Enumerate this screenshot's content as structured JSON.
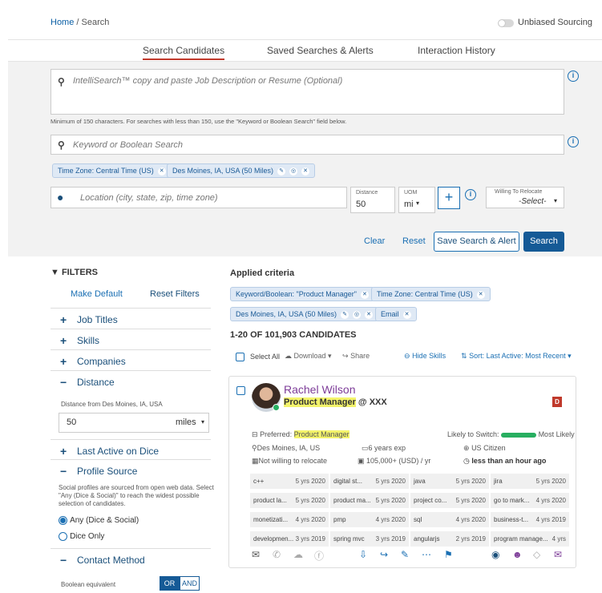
{
  "breadcrumb": {
    "home": "Home",
    "sep": "/",
    "current": "Search"
  },
  "unbiased": "Unbiased Sourcing",
  "tabs": [
    "Search Candidates",
    "Saved Searches & Alerts",
    "Interaction History"
  ],
  "intellisearch": {
    "placeholder": "IntelliSearch™ copy and paste Job Description or Resume (Optional)",
    "hint": "Minimum of 150 characters. For searches with less than 150, use the \"Keyword or Boolean Search\" field below."
  },
  "keyword": {
    "placeholder": "Keyword or Boolean Search"
  },
  "chips": {
    "timezone": "Time Zone: Central Time (US)",
    "location": "Des Moines, IA, USA (50 Miles)"
  },
  "location": {
    "placeholder": "Location (city, state, zip, time zone)",
    "distance_label": "Distance",
    "distance_value": "50",
    "uom_label": "UOM",
    "uom_value": "mi",
    "relocate_label": "Willing To Relocate",
    "relocate_value": "-Select-"
  },
  "actions": {
    "clear": "Clear",
    "reset": "Reset",
    "save": "Save Search & Alert",
    "search": "Search"
  },
  "filters": {
    "title": "FILTERS",
    "make_default": "Make Default",
    "reset": "Reset Filters",
    "sections": [
      "Job Titles",
      "Skills",
      "Companies",
      "Distance",
      "Last Active on Dice",
      "Profile Source",
      "Contact Method"
    ],
    "distance_from": "Distance from Des Moines, IA, USA",
    "distance_value": "50",
    "distance_unit": "miles",
    "source_note": "Social profiles are sourced from open web data. Select \"Any (Dice & Social)\" to reach the widest possible selection of candidates.",
    "source_any": "Any (Dice & Social)",
    "source_dice": "Dice Only",
    "boolean_label": "Boolean equivalent",
    "or": "OR",
    "and": "AND"
  },
  "applied": {
    "title": "Applied criteria",
    "chips": [
      "Keyword/Boolean: \"Product Manager\"",
      "Time Zone: Central Time (US)",
      "Des Moines, IA, USA (50 Miles)",
      "Email"
    ]
  },
  "results": {
    "count": "1-20 OF 101,903 CANDIDATES",
    "select_all": "Select All",
    "download": "Download",
    "share": "Share",
    "hide_skills": "Hide Skills",
    "sort": "Sort: Last Active: Most Recent"
  },
  "candidate": {
    "name": "Rachel Wilson",
    "title": "Product Manager",
    "company": "@ XXX",
    "preferred_label": "Preferred:",
    "preferred": "Product Manager",
    "likely": "Likely to Switch:",
    "likely_value": "Most Likely",
    "location": "Des Moines, IA, US",
    "exp": "6 years exp",
    "citizen": "US Citizen",
    "relocate": "Not willing to relocate",
    "salary": "105,000+ (USD) / yr",
    "active": "less than an hour ago",
    "skills": [
      [
        "c++",
        "5 yrs",
        "2020"
      ],
      [
        "digital st...",
        "5 yrs",
        "2020"
      ],
      [
        "java",
        "5 yrs",
        "2020"
      ],
      [
        "jira",
        "5 yrs",
        "2020"
      ],
      [
        "product la...",
        "5 yrs",
        "2020"
      ],
      [
        "product ma...",
        "5 yrs",
        "2020"
      ],
      [
        "project co...",
        "5 yrs",
        "2020"
      ],
      [
        "go to mark...",
        "4 yrs",
        "2020"
      ],
      [
        "monetizati...",
        "4 yrs",
        "2020"
      ],
      [
        "pmp",
        "4 yrs",
        "2020"
      ],
      [
        "sql",
        "4 yrs",
        "2020"
      ],
      [
        "business-t...",
        "4 yrs",
        "2019"
      ],
      [
        "developmen...",
        "3 yrs",
        "2019"
      ],
      [
        "spring mvc",
        "3 yrs",
        "2019"
      ],
      [
        "angularjs",
        "2 yrs",
        "2019"
      ],
      [
        "program manage...",
        "4 yrs",
        ""
      ]
    ]
  },
  "colors": {
    "primary": "#1a6fb3",
    "brand_red": "#c0392b",
    "chip_bg": "#dfe9f5",
    "highlight": "#f3f36b",
    "green": "#27ae60"
  }
}
